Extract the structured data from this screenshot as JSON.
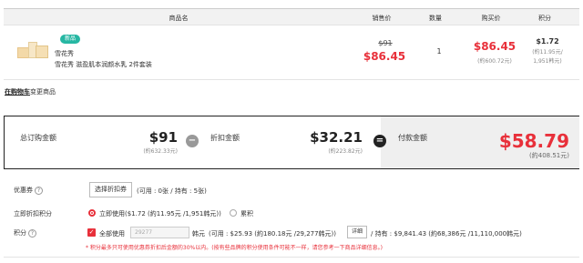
{
  "table": {
    "headers": {
      "product": "商品名",
      "sale_price": "销售价",
      "quantity": "数量",
      "purchase_price": "购买价",
      "points": "积分"
    }
  },
  "product": {
    "badge": "新品",
    "brand": "雪花秀",
    "name": "雪花秀 滋盈肌本润颜水乳 2件套装",
    "original_price": "$91",
    "sale_price": "$86.45",
    "quantity": "1",
    "purchase_price": "$86.45",
    "purchase_price_krw": "(約600.72元)",
    "points": "$1.72",
    "points_krw1": "(約11.95元/",
    "points_krw2": "1,951韩元)"
  },
  "change_link": {
    "link": "在购物车",
    "rest": "变更商品"
  },
  "totals": {
    "order_label": "总订购金额",
    "order_value": "$91",
    "order_krw": "(約632.33元)",
    "minus_symbol": "−",
    "discount_label": "折扣金额",
    "discount_value": "$32.21",
    "discount_krw": "(約223.82元)",
    "equals_symbol": "=",
    "pay_label": "付款金额",
    "pay_value": "$58.79",
    "pay_krw": "(約408.51元)"
  },
  "coupon": {
    "label": "优惠券",
    "help": "?",
    "button": "选择折扣券",
    "info": "(可用 : 0张 / 持有 : 5张)"
  },
  "instant_discount": {
    "label": "立即折扣积分",
    "option1": "立即使用($1.72 (約11.95元 /1,951韩元))",
    "option2": "累积"
  },
  "points_use": {
    "label": "积分",
    "help": "?",
    "use_all": "全部使用",
    "input_placeholder": "29277",
    "unit": "韩元",
    "available": "(可用 : $25.93 (約180.18元 /29,277韩元))",
    "detail_button": "详细",
    "held": "/ 持有 : $9,841.43 (約68,386元 /11,110,000韩元)",
    "note": "* 积分最多只可使用优惠券折扣后金额的30%以内。(按有些品牌的积分使用条件可能不一样，请您参考一下商品详细信息。)"
  },
  "colors": {
    "accent_red": "#e8303a",
    "badge_green": "#26b7a3",
    "minus_circle": "#999999",
    "equals_circle": "#222222"
  }
}
